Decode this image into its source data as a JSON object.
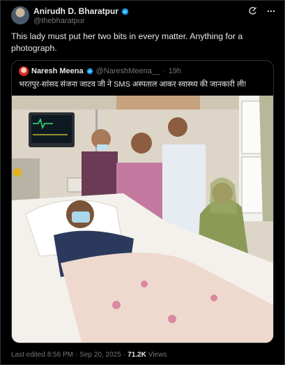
{
  "tweet": {
    "author_name": "Anirudh D. Bharatpur",
    "author_handle": "@thebharatpur",
    "text": "This lady must put her two bits in every matter. Anything for a photograph.",
    "footer": {
      "edited": "Last edited 8:56 PM",
      "sep1": "·",
      "date": "Sep 20, 2025",
      "sep2": "·",
      "views_count": "71.2K",
      "views_label": "Views"
    }
  },
  "quoted": {
    "author_name": "Naresh Meena",
    "author_handle": "@NareshMeena__",
    "sep": "·",
    "time": "19h",
    "text": "भरतपुर-सांसद संजना जाटव जी ने SMS अस्पताल आकर स्वास्थ्य की जानकारी ली!"
  },
  "icons": {
    "verified": "verified-badge-icon",
    "grok": "grok-icon",
    "more": "more-options-icon"
  },
  "colors": {
    "verified": "#1d9bf0",
    "muted": "#71767b",
    "border": "#2f3336"
  }
}
